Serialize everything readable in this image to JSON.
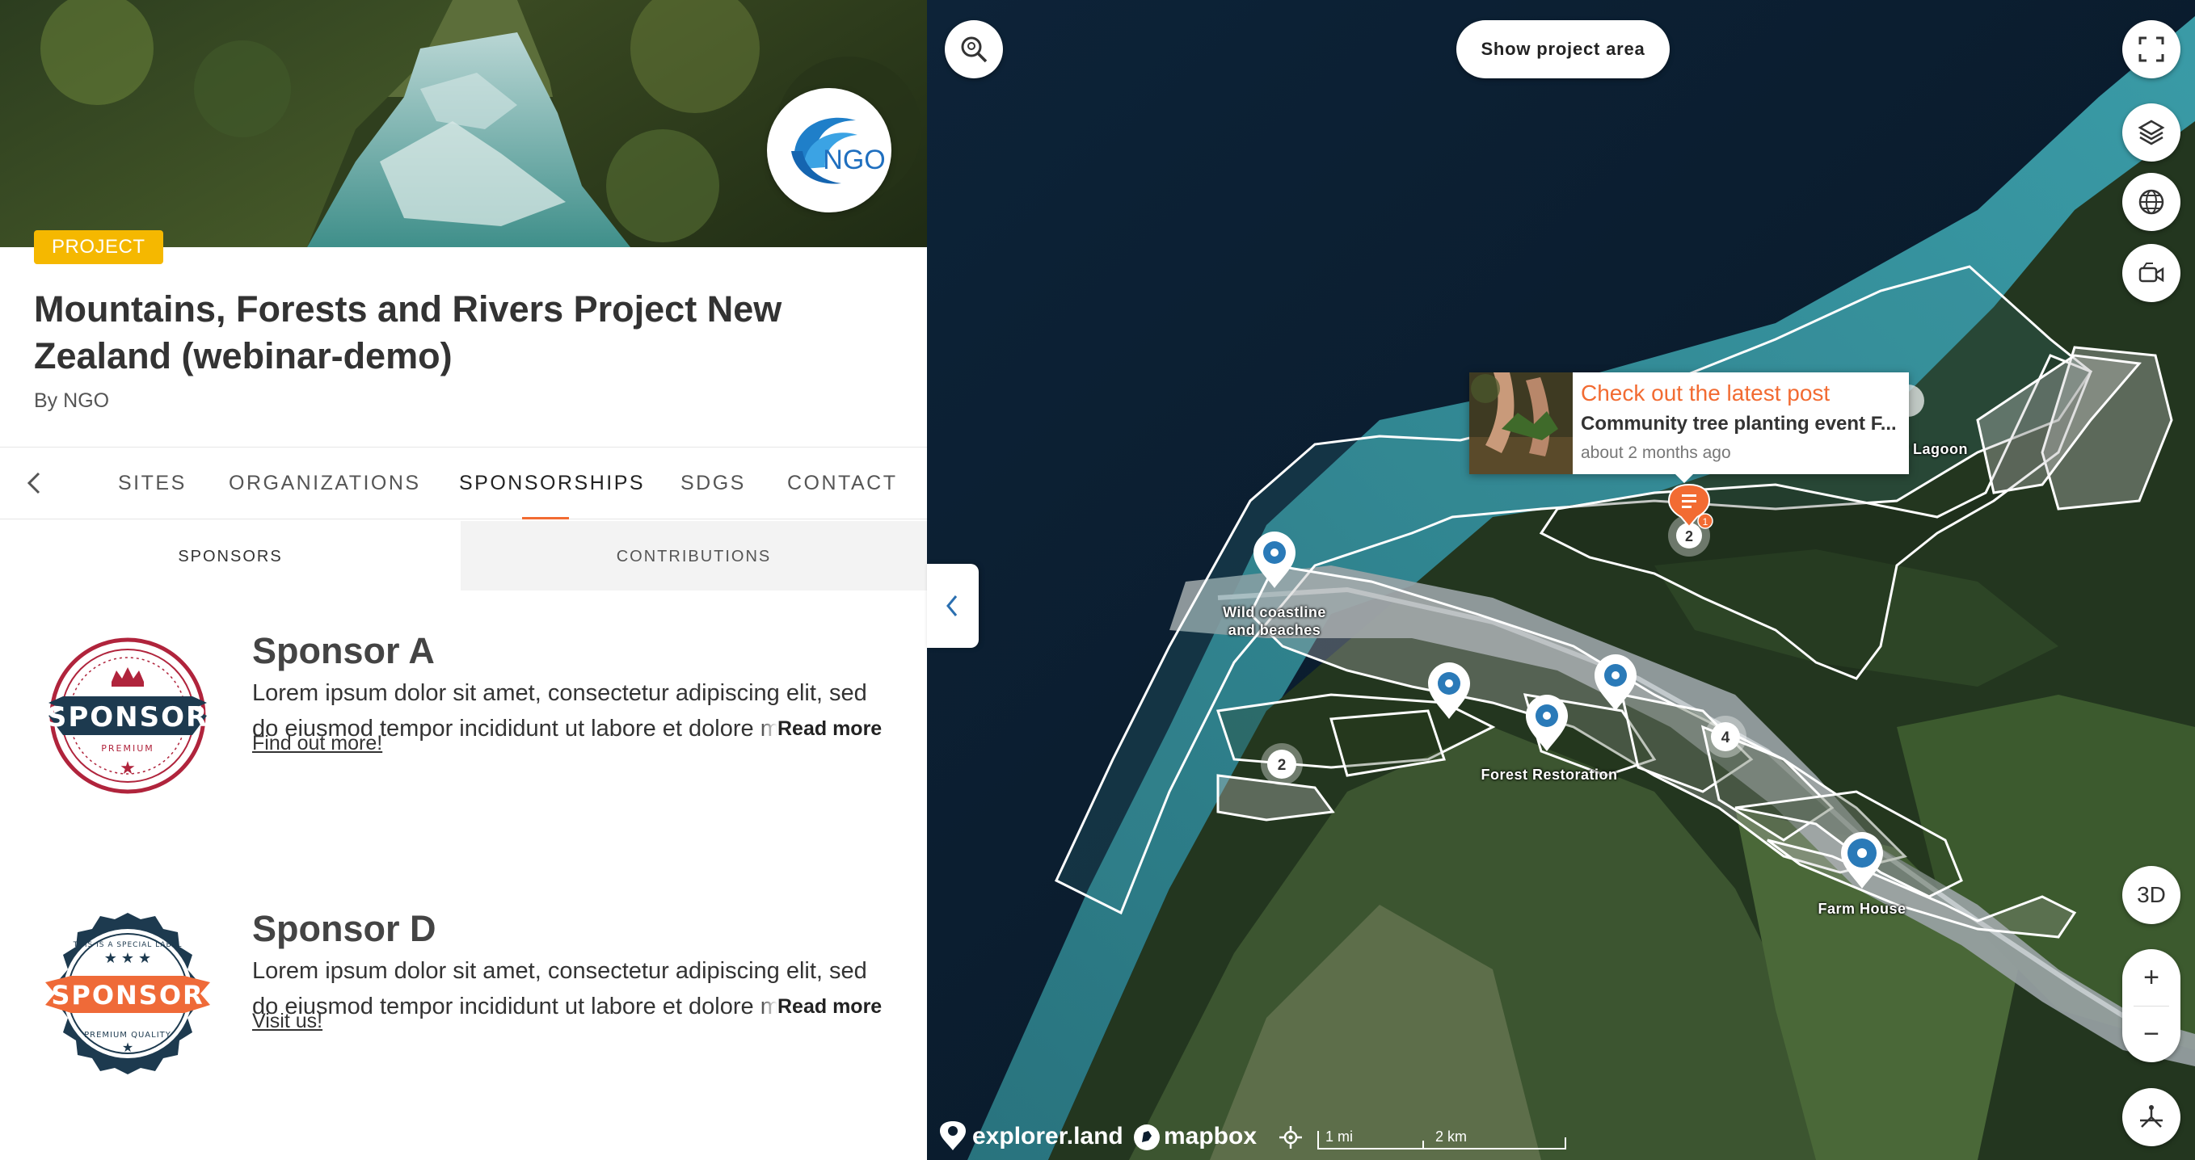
{
  "project": {
    "badge": "PROJECT",
    "title": "Mountains, Forests and Rivers Project New Zealand (webinar-demo)",
    "by_prefix": "By",
    "organization": "NGO",
    "logo_text": "NGO"
  },
  "tabs": {
    "items": [
      {
        "label": "SITES",
        "active": false
      },
      {
        "label": "ORGANIZATIONS",
        "active": false
      },
      {
        "label": "SPONSORSHIPS",
        "active": true
      },
      {
        "label": "SDGS",
        "active": false
      },
      {
        "label": "CONTACT",
        "active": false
      }
    ]
  },
  "subtabs": {
    "sponsors": "SPONSORS",
    "contributions": "CONTRIBUTIONS"
  },
  "sponsors": [
    {
      "name": "Sponsor A",
      "description": "Lorem ipsum dolor sit amet, consectetur adipiscing elit, sed do eiusmod tempor incididunt ut labore et dolore magna aliqua.",
      "read_more": "Read more",
      "link": "Find out more!",
      "logo_text": "SPONSOR",
      "logo_subtext": "PREMIUM"
    },
    {
      "name": "Sponsor D",
      "description": "Lorem ipsum dolor sit amet, consectetur adipiscing elit, sed do eiusmod tempor incididunt ut labore et dolore magna aliqua.",
      "read_more": "Read more",
      "link": "Visit us!",
      "logo_text": "SPONSOR",
      "logo_top_text": "THIS IS A SPECIAL LABEL",
      "logo_bottom_text": "PREMIUM QUALITY"
    }
  ],
  "map": {
    "show_area_button": "Show project area",
    "three_d_button": "3D",
    "zoom_in": "+",
    "zoom_out": "−",
    "labels": {
      "wild_coastline_1": "Wild coastline",
      "wild_coastline_2": "and beaches",
      "forest_restoration": "Forest Restoration",
      "farm_house": "Farm House",
      "lagoon": "r Lagoon"
    },
    "clusters": {
      "cluster_left": "2",
      "cluster_right": "4",
      "cluster_top": "2"
    },
    "post_badge": "1",
    "popup": {
      "title": "Check out the latest post",
      "text": "Community tree planting event F...",
      "time": "about 2 months ago"
    },
    "attribution": {
      "explorer": "explorer.land",
      "mapbox": "mapbox",
      "scale_mi": "1 mi",
      "scale_km": "2 km"
    }
  },
  "colors": {
    "accent": "#f26b32",
    "badge": "#f5b800",
    "pin_blue": "#2a7ab8"
  }
}
